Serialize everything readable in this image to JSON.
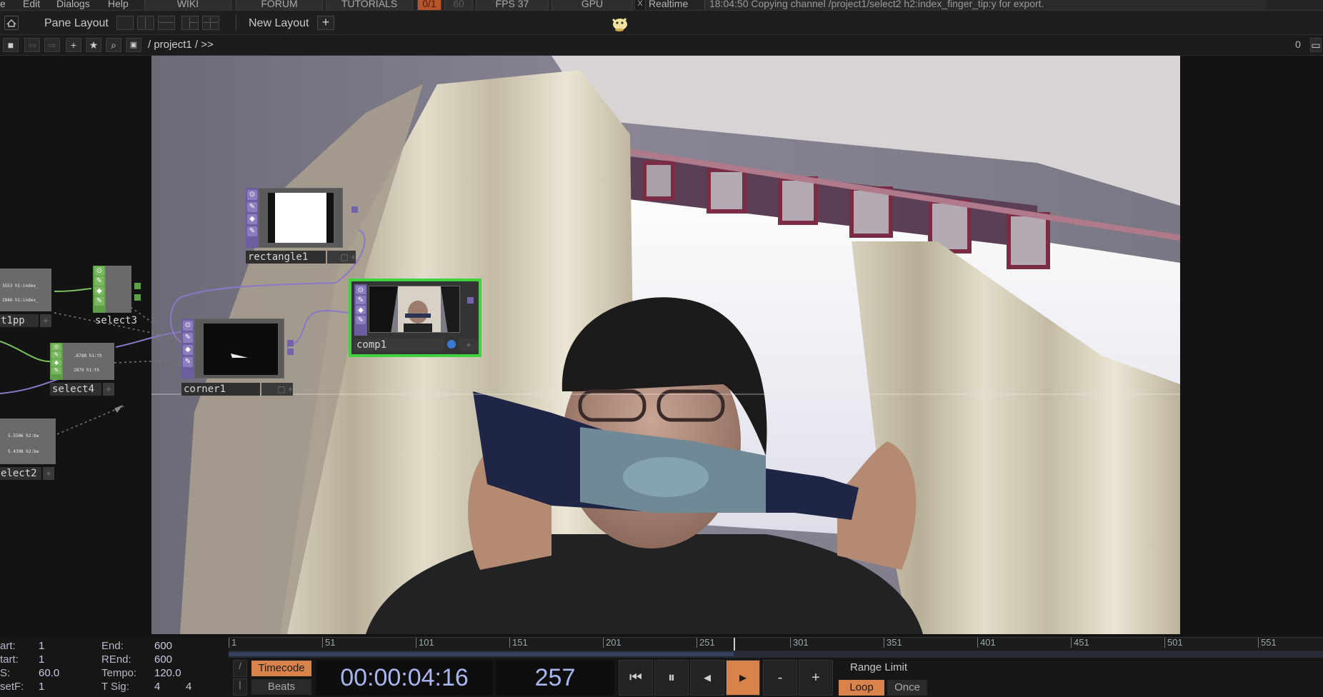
{
  "menu": {
    "items": [
      "e",
      "Edit",
      "Dialogs",
      "Help"
    ],
    "tabs": [
      "WIKI",
      "FORUM",
      "TUTORIALS"
    ],
    "fps_value": "0/1",
    "fps_target": "60",
    "fps_label": "FPS  37",
    "gpu_label": "GPU",
    "realtime_label": "Realtime",
    "realtime_checked": "X",
    "status_text": "18:04:50 Copying channel /project1/select2 h2:index_finger_tip:y for export."
  },
  "panebar": {
    "pane_layout_label": "Pane Layout",
    "new_layout_label": "New Layout",
    "add_label": "+"
  },
  "pathbar": {
    "path": "/ project1 / >>",
    "right_value": "0"
  },
  "nodes": {
    "rectangle1": "rectangle1",
    "comp1": "comp1",
    "corner1": "corner1",
    "select3": "select3",
    "select4": "select4",
    "select2": "elect2",
    "t1pp": "t1pp",
    "mini_text_1": "3553 h1:index_",
    "mini_text_2": "2846 h1:index_",
    "mini_text_3": ".6788 h1:th",
    "mini_text_4": "2879 h1:th",
    "mini_text_5": "5.5506 h2:bw",
    "mini_text_6": "5.4398 h2:bw"
  },
  "timeline": {
    "ruler": [
      "1",
      "51",
      "101",
      "151",
      "201",
      "251",
      "301",
      "351",
      "401",
      "451",
      "501",
      "551"
    ],
    "current_frame_progress": 0.4612,
    "start_label": "art:",
    "start_value": "1",
    "rstart_label": "tart:",
    "rstart_value": "1",
    "fps_label": "S:",
    "fps_value": "60.0",
    "offset_label": "setF:",
    "offset_value": "1",
    "end_label": "End:",
    "end_value": "600",
    "rend_label": "REnd:",
    "rend_value": "600",
    "tempo_label": "Tempo:",
    "tempo_value": "120.0",
    "tsig_label": "T Sig:",
    "tsig_num": "4",
    "tsig_den": "4",
    "timecode_btn": "Timecode",
    "beats_btn": "Beats",
    "timecode": "00:00:04:16",
    "frame": "257",
    "range_limit": "Range Limit",
    "loop": "Loop",
    "once": "Once",
    "minus": "-",
    "plus": "+"
  },
  "colors": {
    "accent_orange": "#d8834c",
    "selected_node": "#3ed23e",
    "comp_purple": "#6e5d9e",
    "chop_green": "#5e9e49"
  }
}
